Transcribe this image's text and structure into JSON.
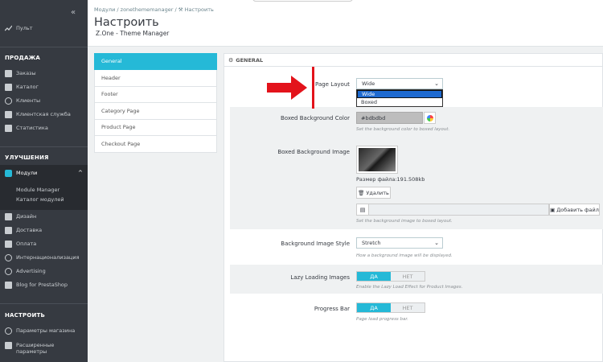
{
  "sidebar": {
    "collapse": "«",
    "dashboard": "Пульт",
    "sections": [
      {
        "title": "ПРОДАЖА",
        "items": [
          "Заказы",
          "Каталог",
          "Клиенты",
          "Клиентская служба",
          "Статистика"
        ]
      },
      {
        "title": "УЛУЧШЕНИЯ",
        "items": [
          "Модули",
          "Дизайн",
          "Доставка",
          "Оплата",
          "Интернационализация",
          "Advertising",
          "Blog for PrestaShop"
        ]
      },
      {
        "title": "НАСТРОИТЬ",
        "items": [
          "Параметры магазина",
          "Расширенные",
          "параметры"
        ]
      }
    ],
    "subitems": [
      "Module Manager",
      "Каталог модулей"
    ]
  },
  "header": {
    "breadcrumb": [
      "Модули",
      "zonethememanager",
      "Настроить"
    ],
    "breadcrumb_sep": "/",
    "title": "Настроить",
    "subtitle": "Z.One - Theme Manager"
  },
  "tabs": [
    "General",
    "Header",
    "Footer",
    "Category Page",
    "Product Page",
    "Checkout Page"
  ],
  "panel": {
    "heading": "GENERAL",
    "page_layout": {
      "label": "Page Layout",
      "value": "Wide",
      "options": [
        "Wide",
        "Boxed"
      ]
    },
    "boxed_bg_color": {
      "label": "Boxed Background Color",
      "value": "#bdbdbd",
      "help": "Set the background color to boxed layout."
    },
    "boxed_bg_image": {
      "label": "Boxed Background Image",
      "file_size": "Размер файла:191.508kb",
      "delete": "Удалить",
      "add_file": "Добавить файл",
      "help": "Set the background image to boxed layout."
    },
    "bg_image_style": {
      "label": "Background Image Style",
      "value": "Stretch",
      "help": "How a background image will be displayed."
    },
    "lazy_loading": {
      "label": "Lazy Loading Images",
      "on": "ДА",
      "off": "НЕТ",
      "help": "Enable the Lazy Load Effect for Product Images."
    },
    "progress_bar": {
      "label": "Progress Bar",
      "on": "ДА",
      "off": "НЕТ",
      "help": "Page load progress bar."
    }
  },
  "colors": {
    "accent": "#25b9d7",
    "sidebar": "#363a41",
    "annotation": "#e3131b"
  }
}
